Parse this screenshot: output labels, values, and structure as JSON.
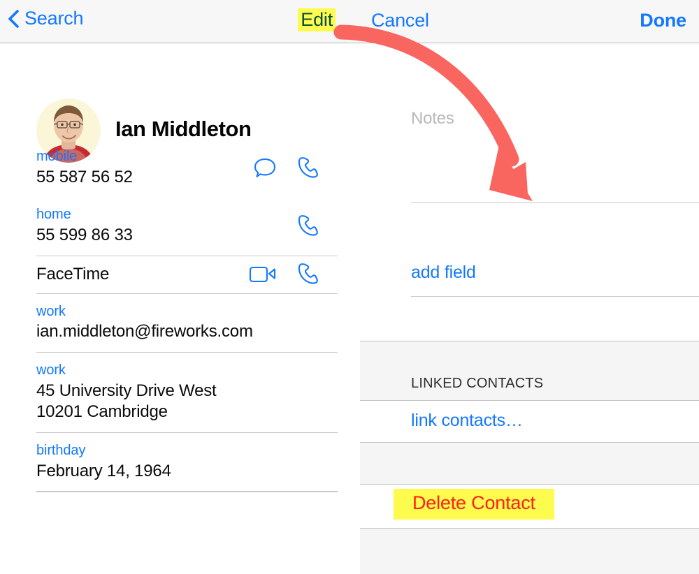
{
  "left_panel": {
    "navbar": {
      "back_icon": "chevron-left-icon",
      "back_label": "Search",
      "edit_label": "Edit",
      "edit_highlight_color": "#fdfb4e",
      "edit_text_color": "#0b4d3a"
    },
    "contact": {
      "avatar_alt": "contact-photo",
      "name": "Ian Middleton"
    },
    "fields": [
      {
        "label": "mobile",
        "value": "55 587 56 52",
        "actions": [
          "message-bubble-icon",
          "phone-handset-icon"
        ],
        "divider_after": false
      },
      {
        "label": "home",
        "value": "55 599 86 33",
        "actions": [
          "phone-handset-icon"
        ],
        "divider_after": true
      },
      {
        "label": "",
        "value": "FaceTime",
        "actions": [
          "video-camera-icon",
          "phone-handset-icon"
        ],
        "divider_after": true
      },
      {
        "label": "work",
        "value": "ian.middleton@fireworks.com",
        "actions": [],
        "divider_after": true
      },
      {
        "label": "work",
        "value": "45 University Drive West\n10201 Cambridge",
        "actions": [],
        "divider_after": true
      },
      {
        "label": "birthday",
        "value": "February 14, 1964",
        "actions": [],
        "divider_after": true
      }
    ]
  },
  "right_panel": {
    "navbar": {
      "cancel_label": "Cancel",
      "done_label": "Done"
    },
    "notes": {
      "placeholder": "Notes",
      "value": ""
    },
    "add_field_label": "add field",
    "linked_contacts": {
      "section_header": "LINKED CONTACTS",
      "link_icon": "plus-circle-icon",
      "link_label": "link contacts…"
    },
    "delete": {
      "label": "Delete Contact",
      "highlight_color": "#fdfb4e",
      "text_color": "#ff2018"
    }
  },
  "annotation": {
    "arrow_icon": "curved-arrow-icon",
    "arrow_color": "#f9655f"
  },
  "colors": {
    "tint_blue": "#1478ff",
    "destructive_red": "#ff2018",
    "green_add": "#3fcd5b",
    "navbar_bg": "#f7f7f7",
    "separator": "#c9c9c9",
    "placeholder_gray": "#b9b9b9"
  }
}
